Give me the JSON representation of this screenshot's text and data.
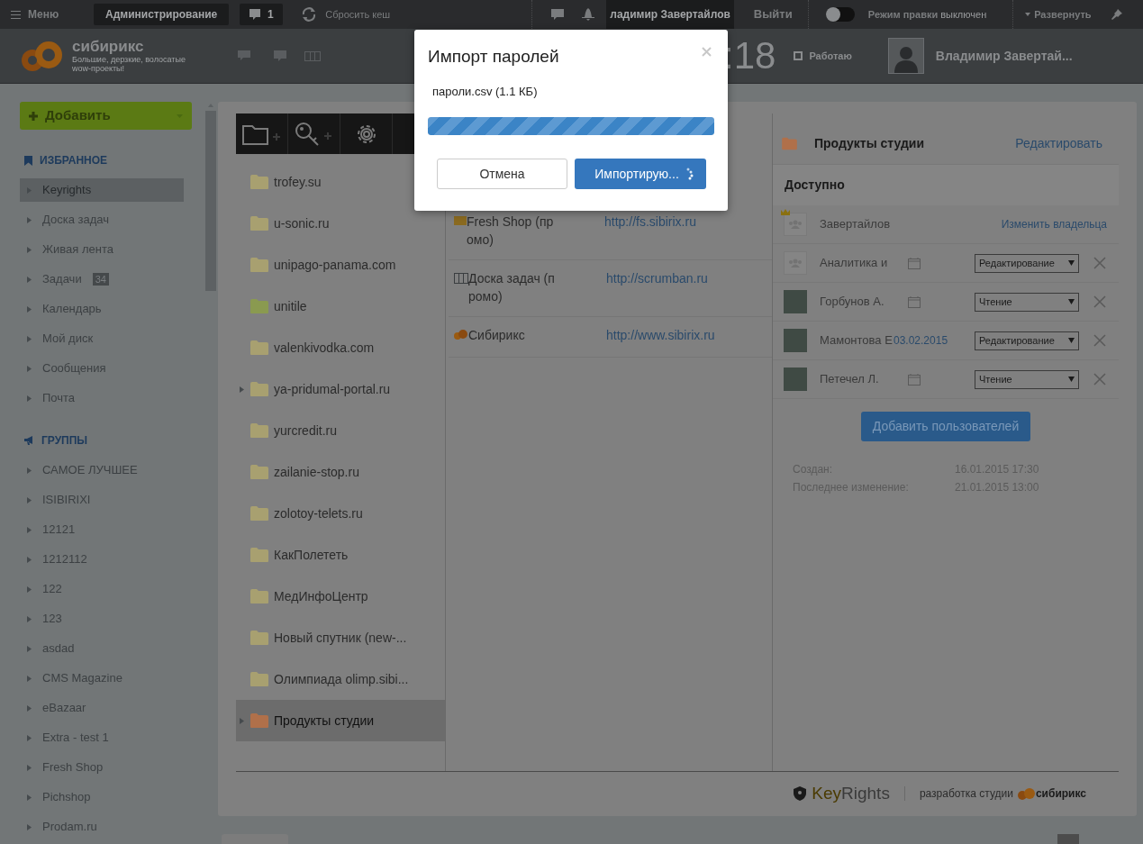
{
  "top_bar": {
    "menu": "Меню",
    "admin": "Администрирование",
    "notifications": "1",
    "clear_cache": "Сбросить кеш",
    "user": "ладимир Завертайлов",
    "logout": "Выйти",
    "edit_mode": {
      "label": "Режим правки",
      "state": "выключен",
      "on": false
    },
    "expand": "Развернуть"
  },
  "header": {
    "logo": "сибирикс",
    "tagline": "Большие, дерзкие, волосатые wow-проекты!",
    "clock": ":18",
    "status": "Работаю",
    "user": "Владимир Завертай..."
  },
  "sidebar": {
    "add_button": "Добавить",
    "sections": [
      {
        "kind": "favorites",
        "title": "ИЗБРАННОЕ",
        "items": [
          {
            "label": "Keyrights",
            "selected": true
          },
          {
            "label": "Доска задач",
            "selected": false
          },
          {
            "label": "Живая лента",
            "selected": false
          },
          {
            "label": "Задачи",
            "selected": false,
            "count": "34"
          },
          {
            "label": "Календарь",
            "selected": false
          },
          {
            "label": "Мой диск",
            "selected": false
          },
          {
            "label": "Сообщения",
            "selected": false
          },
          {
            "label": "Почта",
            "selected": false
          }
        ]
      },
      {
        "kind": "groups",
        "title": "ГРУППЫ",
        "items": [
          {
            "label": "САМОЕ ЛУЧШЕЕ",
            "selected": false
          },
          {
            "label": "ISIBIRIXI",
            "selected": false
          },
          {
            "label": "12121",
            "selected": false
          },
          {
            "label": "1212112",
            "selected": false
          },
          {
            "label": "122",
            "selected": false
          },
          {
            "label": "123",
            "selected": false
          },
          {
            "label": "asdad",
            "selected": false
          },
          {
            "label": "CMS Magazine",
            "selected": false
          },
          {
            "label": "eBazaar",
            "selected": false
          },
          {
            "label": "Extra - test 1",
            "selected": false
          },
          {
            "label": "Fresh Shop",
            "selected": false
          },
          {
            "label": "Pichshop",
            "selected": false
          },
          {
            "label": "Prodam.ru",
            "selected": false
          }
        ]
      }
    ]
  },
  "folders": [
    {
      "name": "trofey.su",
      "color": "#a8a070",
      "expandable": false,
      "selected": false
    },
    {
      "name": "u-sonic.ru",
      "color": "#a8a070",
      "expandable": false,
      "selected": false
    },
    {
      "name": "unipago-panama.com",
      "color": "#a8a070",
      "expandable": false,
      "selected": false
    },
    {
      "name": "unitile",
      "color": "#8a9a50",
      "expandable": false,
      "selected": false
    },
    {
      "name": "valenkivodka.com",
      "color": "#a8a070",
      "expandable": false,
      "selected": false
    },
    {
      "name": "ya-pridumal-portal.ru",
      "color": "#a8a070",
      "expandable": true,
      "selected": false
    },
    {
      "name": "yurcredit.ru",
      "color": "#a8a070",
      "expandable": false,
      "selected": false
    },
    {
      "name": "zailanie-stop.ru",
      "color": "#a8a070",
      "expandable": false,
      "selected": false
    },
    {
      "name": "zolotoy-telets.ru",
      "color": "#a8a070",
      "expandable": false,
      "selected": false
    },
    {
      "name": "КакПолететь",
      "color": "#a8a070",
      "expandable": false,
      "selected": false
    },
    {
      "name": "МедИнфоЦентр",
      "color": "#a8a070",
      "expandable": false,
      "selected": false
    },
    {
      "name": "Новый спутник (new-...",
      "color": "#a8a070",
      "expandable": false,
      "selected": false
    },
    {
      "name": "Олимпиада olimp.sibi...",
      "color": "#a8a070",
      "expandable": false,
      "selected": false
    },
    {
      "name": "Продукты студии",
      "color": "#b0704a",
      "expandable": true,
      "selected": true
    }
  ],
  "entries": [
    {
      "kind": "folder",
      "name": "Fresh Shop (промо)",
      "url": "http://fs.sibirix.ru"
    },
    {
      "kind": "board",
      "name": "Доска задач (промо)",
      "url": "http://scrumban.ru"
    },
    {
      "kind": "logo",
      "name": "Сибирикс",
      "url": "http://www.sibirix.ru"
    }
  ],
  "details": {
    "title": "Продукты студии",
    "edit": "Редактировать",
    "access_title": "Доступно",
    "owner": {
      "name": "Завертайлов",
      "action": "Изменить владельца"
    },
    "users": [
      {
        "kind": "group",
        "name": "Аналитика и",
        "role": "Редактирование"
      },
      {
        "kind": "photo",
        "name": "Горбунов А.",
        "role": "Чтение"
      },
      {
        "kind": "photo",
        "name": "Мамонтова Е",
        "date": "03.02.2015",
        "role": "Редактирование"
      },
      {
        "kind": "photo",
        "name": "Петечел Л.",
        "role": "Чтение"
      }
    ],
    "add_users": "Добавить пользователей",
    "meta": [
      {
        "label": "Создан:",
        "value": "16.01.2015 17:30"
      },
      {
        "label": "Последнее изменение:",
        "value": "21.01.2015 13:00"
      }
    ]
  },
  "footer": {
    "product": {
      "prefix": "Key",
      "suffix": "Rights"
    },
    "credit": "разработка студии",
    "studio": "сибирикс"
  },
  "dialog": {
    "title": "Импорт паролей",
    "file": "пароли.csv (1.1 КБ)",
    "progress": {
      "level": 1
    },
    "cancel": "Отмена",
    "confirm": "Импортирую..."
  }
}
